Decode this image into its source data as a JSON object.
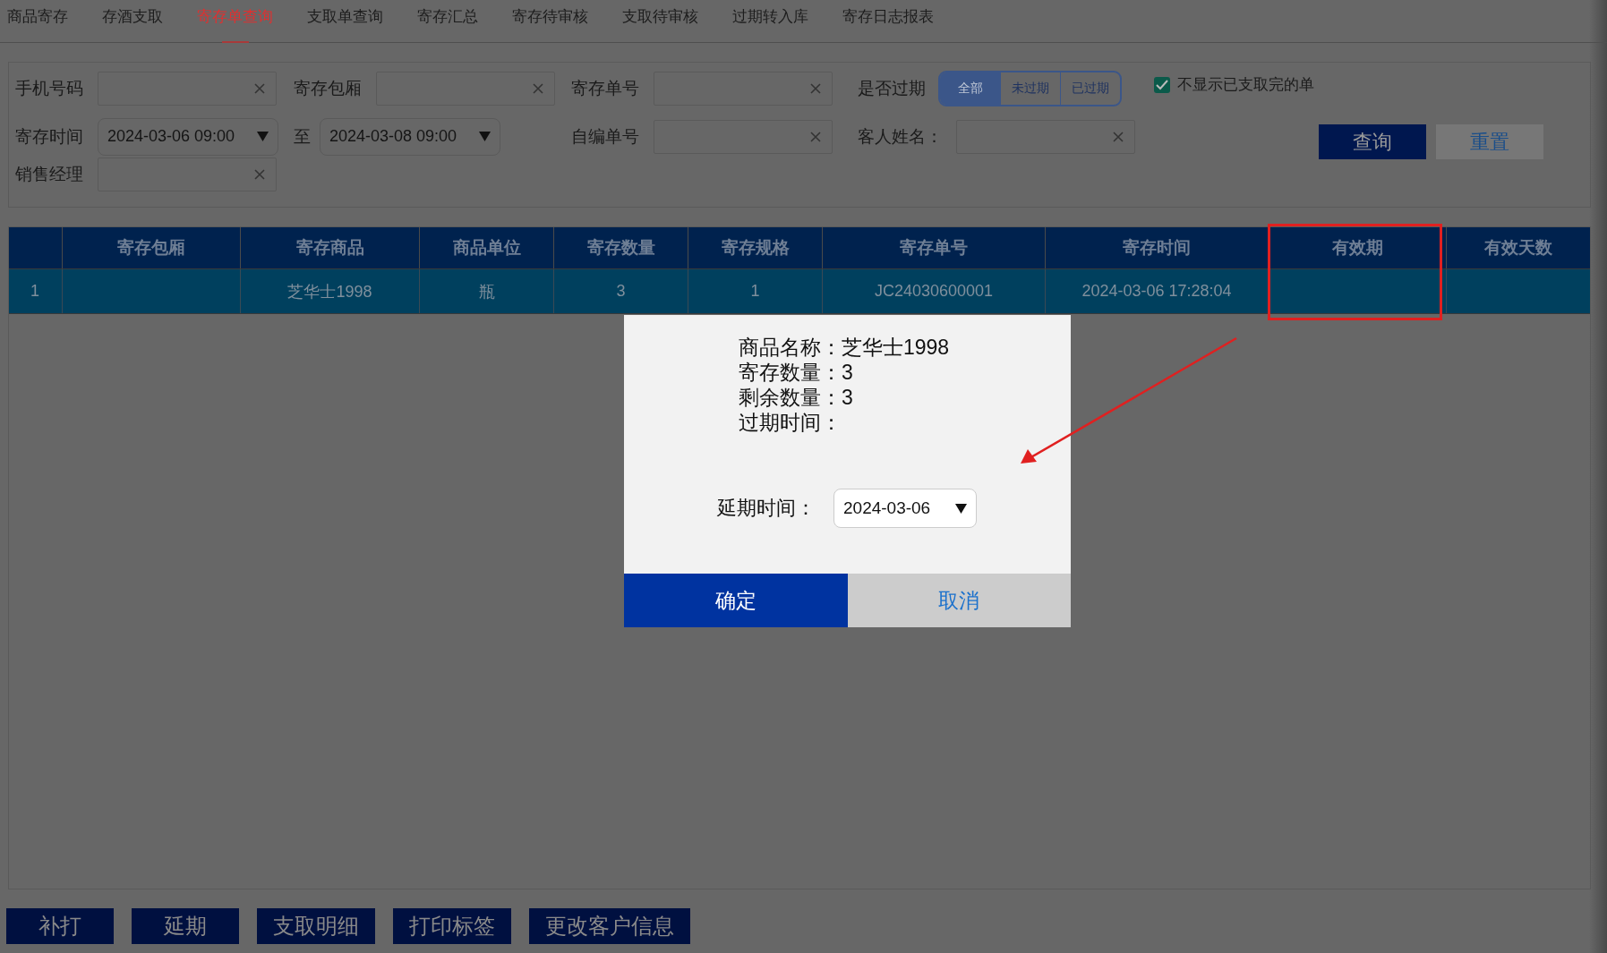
{
  "tabs": [
    {
      "label": "商品寄存",
      "selected": false
    },
    {
      "label": "存酒支取",
      "selected": false
    },
    {
      "label": "寄存单查询",
      "selected": true
    },
    {
      "label": "支取单查询",
      "selected": false
    },
    {
      "label": "寄存汇总",
      "selected": false
    },
    {
      "label": "寄存待审核",
      "selected": false
    },
    {
      "label": "支取待审核",
      "selected": false
    },
    {
      "label": "过期转入库",
      "selected": false
    },
    {
      "label": "寄存日志报表",
      "selected": false
    }
  ],
  "filter_rows": [
    [
      {
        "kind": "text",
        "label": "手机号码"
      },
      {
        "kind": "text",
        "label": "寄存包厢"
      },
      {
        "kind": "text",
        "label": "寄存单号"
      },
      {
        "kind": "segmented",
        "label": "是否过期",
        "options": [
          {
            "label": "全部",
            "selected": true
          },
          {
            "label": "未过期",
            "selected": false
          },
          {
            "label": "已过期",
            "selected": false
          }
        ]
      },
      {
        "kind": "checkbox",
        "label": "不显示已支取完的单",
        "checked": true
      }
    ],
    [
      {
        "kind": "date",
        "label": "寄存时间",
        "value": "2024-03-06 09:00"
      },
      {
        "kind": "date",
        "label": "至",
        "value": "2024-03-08 09:00"
      },
      {
        "kind": "text",
        "label": "自编单号"
      },
      {
        "kind": "text",
        "label": "客人姓名："
      },
      {
        "kind": "actions",
        "buttons": [
          {
            "label": "查询",
            "primary": true
          },
          {
            "label": "重置",
            "primary": false
          }
        ]
      }
    ],
    [
      {
        "kind": "text",
        "label": "销售经理"
      }
    ]
  ],
  "table": {
    "columns": [
      "寄存包厢",
      "寄存商品",
      "商品单位",
      "寄存数量",
      "寄存规格",
      "寄存单号",
      "寄存时间",
      "有效期",
      "有效天数"
    ],
    "rows": [
      {
        "index": "1",
        "selected": true,
        "cells": [
          "",
          "芝华士1998",
          "瓶",
          "3",
          "1",
          "JC24030600001",
          "2024-03-06 17:28:04",
          "",
          ""
        ]
      }
    ]
  },
  "bottom_buttons": [
    "补打",
    "延期",
    "支取明细",
    "打印标签",
    "更改客户信息"
  ],
  "dialog": {
    "lines": [
      {
        "label": "商品名称：",
        "value": "芝华士1998"
      },
      {
        "label": "寄存数量：",
        "value": "3"
      },
      {
        "label": "剩余数量：",
        "value": "3"
      },
      {
        "label": "过期时间："
      }
    ],
    "extend_label": "延期时间：",
    "extend_value": "2024-03-06",
    "buttons": [
      {
        "label": "确定",
        "primary": true
      },
      {
        "label": "取消",
        "primary": false
      }
    ]
  }
}
